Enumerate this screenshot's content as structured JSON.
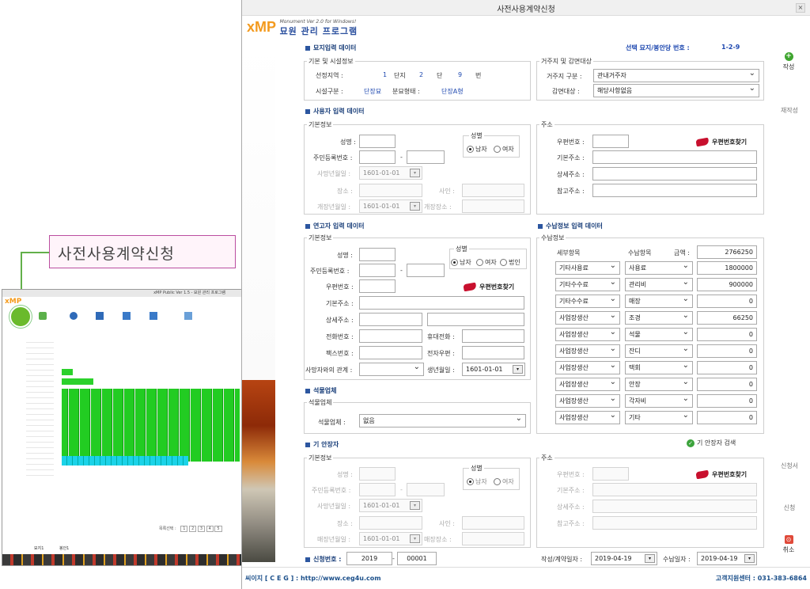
{
  "window": {
    "title": "사전사용계약신청",
    "close": "×"
  },
  "logo": {
    "brand": "xMP",
    "subtitle": "Monument Ver 2.0 for Windows!",
    "title": "묘원 관리 프로그램"
  },
  "callout": {
    "label": "사전사용계약신청"
  },
  "thumb": {
    "title": "xMP Public Ver 1.5 - 묘원 관리 프로그램",
    "pager": "목록선택 :",
    "pages": [
      "1",
      "2",
      "3",
      "4",
      "5"
    ],
    "tabs": [
      "묘지1",
      "봉안1"
    ]
  },
  "tomb": {
    "section": "묘지입력 데이터",
    "selected_label": "선택 묘지/봉안당 번호 :",
    "selected_value": "1-2-9",
    "basic_group": "기본 및 시설정보",
    "region_label": "선정지역 :",
    "region": "1",
    "danji_label": "단지",
    "danji": "2",
    "dan_label": "단",
    "dan": "9",
    "beon_label": "번",
    "facility_label": "시설구분 :",
    "facility": "단장묘",
    "type_label": "분묘형태 :",
    "type": "단장A형",
    "resid_group": "거주지 및 감면대상",
    "resid_label": "거주지 구분 :",
    "resid_value": "관내거주자",
    "reduce_label": "감면대상 :",
    "reduce_value": "해당사항없음"
  },
  "side": {
    "write": "작성",
    "rewrite": "재작성",
    "apply": "신청서",
    "apply2": "신청",
    "cancel": "취소"
  },
  "user": {
    "section": "사용자 입력 데이터",
    "basic": "기본정보",
    "name": "성명 :",
    "gender": "성별",
    "male": "남자",
    "female": "여자",
    "rrn": "주민등록번호 :",
    "dash": "-",
    "death_label": "사망년월일 :",
    "death_date": "1601-01-01",
    "place": "장소 :",
    "cause": "사인 :",
    "burial_date_label": "개장년월일 :",
    "burial_date": "1601-01-01",
    "burial_place": "개장장소 :",
    "addr": "주소",
    "zip": "우편번호 :",
    "zip_find": "우편번호찾기",
    "base_addr": "기본주소 :",
    "detail_addr": "상세주소 :",
    "ref_addr": "참고주소 :"
  },
  "kin": {
    "section": "연고자 입력 데이터",
    "basic": "기본정보",
    "name": "성명 :",
    "gender": "성별",
    "male": "남자",
    "female": "여자",
    "corp": "법인",
    "rrn": "주민등록번호 :",
    "dash": "-",
    "zip": "우편번호 :",
    "zip_find": "우편번호찾기",
    "base_addr": "기본주소 :",
    "detail_addr": "상세주소 :",
    "phone": "전화번호 :",
    "mobile": "휴대전화 :",
    "fax": "팩스번호 :",
    "email": "전자우편 :",
    "relation": "사망자와의 관계 :",
    "birth_label": "생년월일 :",
    "birth": "1601-01-01"
  },
  "pay": {
    "section": "수납정보 입력 데이터",
    "group": "수납정보",
    "col1": "세부항목",
    "col2": "수납항목",
    "col3": "금액 :",
    "total": "2766250",
    "rows": [
      {
        "cat": "기타사용료",
        "item": "사용료",
        "amt": "1800000"
      },
      {
        "cat": "기타수수료",
        "item": "관리비",
        "amt": "900000"
      },
      {
        "cat": "기타수수료",
        "item": "매장",
        "amt": "0"
      },
      {
        "cat": "사업장생산",
        "item": "조경",
        "amt": "66250"
      },
      {
        "cat": "사업장생산",
        "item": "석물",
        "amt": "0"
      },
      {
        "cat": "사업장생산",
        "item": "잔디",
        "amt": "0"
      },
      {
        "cat": "사업장생산",
        "item": "택회",
        "amt": "0"
      },
      {
        "cat": "사업장생산",
        "item": "안장",
        "amt": "0"
      },
      {
        "cat": "사업장생산",
        "item": "각자비",
        "amt": "0"
      },
      {
        "cat": "사업장생산",
        "item": "기타",
        "amt": "0"
      }
    ]
  },
  "stone": {
    "section": "석물업체",
    "group": "석물업체",
    "label": "석물업체 :",
    "value": "없음"
  },
  "prev": {
    "section": "기 안장자",
    "search": "기 안장자 검색",
    "basic": "기본정보",
    "name": "성명 :",
    "gender": "성별",
    "male": "남자",
    "female": "여자",
    "rrn": "주민등록번호 :",
    "dash": "-",
    "death_label": "사망년월일 :",
    "death_date": "1601-01-01",
    "place": "장소 :",
    "cause": "사인 :",
    "burial_date_label": "매장년월일 :",
    "burial_date": "1601-01-01",
    "burial_place": "매장장소 :",
    "addr": "주소",
    "zip": "우편번호 :",
    "zip_find": "우편번호찾기",
    "base_addr": "기본주소 :",
    "detail_addr": "상세주소 :",
    "ref_addr": "참고주소 :"
  },
  "bottom": {
    "app_no_label": "신청번호 :",
    "app_year": "2019",
    "dash": "-",
    "app_seq": "00001",
    "write_date_label": "작성/계약일자 :",
    "write_date": "2019-04-19",
    "pay_date_label": "수납일자 :",
    "pay_date": "2019-04-19"
  },
  "footer": {
    "company": "씨이지 [ C E G ] : http://www.ceg4u.com",
    "support": "고객지원센터 : 031-383-6864"
  }
}
